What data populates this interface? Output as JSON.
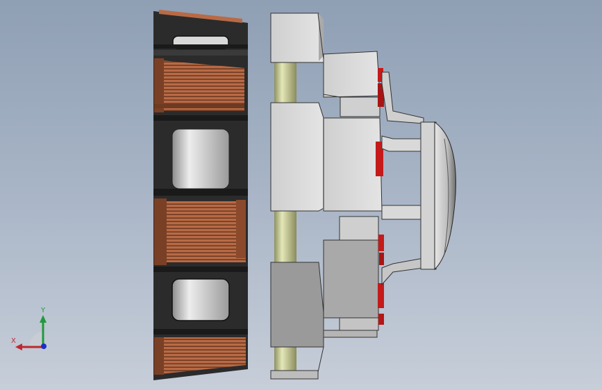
{
  "viewport": {
    "background_top": "#8f9fb4",
    "background_bottom": "#c7ced9"
  },
  "triad": {
    "x_label": "X",
    "y_label": "Y",
    "x_color": "#c0272d",
    "y_color": "#1f9a3a",
    "z_color": "#1c2fc8"
  },
  "colors": {
    "core": "#2b2b2b",
    "copper": "#b86a45",
    "housing": "#d7d7d7",
    "housing_shadow": "#9c9c9c",
    "shaft": "#c8cc9a",
    "red_insert": "#c41a1a"
  }
}
